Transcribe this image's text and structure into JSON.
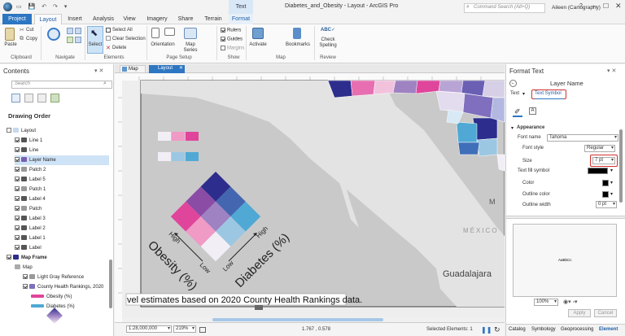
{
  "window": {
    "title": "Diabetes_and_Obesity - Layout - ArcGIS Pro",
    "context_tab_group": "Text",
    "search_placeholder": "Command Search (Alt+Q)",
    "user": "Aileen (Cartography)",
    "help": "?"
  },
  "ribbon_tabs": [
    "Project",
    "Layout",
    "Insert",
    "Analysis",
    "View",
    "Imagery",
    "Share",
    "Terrain",
    "Format"
  ],
  "ribbon": {
    "clipboard": {
      "paste": "Paste",
      "cut": "Cut",
      "copy": "Copy",
      "group": "Clipboard"
    },
    "navigate": {
      "group": "Navigate"
    },
    "elements": {
      "select": "Select",
      "select_all": "Select All",
      "clear_selection": "Clear Selection",
      "delete": "Delete",
      "group": "Elements"
    },
    "page_setup": {
      "orientation": "Orientation",
      "map_series": "Map Series",
      "group": "Page Setup"
    },
    "show": {
      "rulers": "Rulers",
      "guides": "Guides",
      "margins": "Margins",
      "group": "Show"
    },
    "map": {
      "activate": "Activate",
      "bookmarks": "Bookmarks",
      "group": "Map"
    },
    "review": {
      "check_spelling": "Check Spelling",
      "group": "Review"
    }
  },
  "contents": {
    "title": "Contents",
    "search_placeholder": "Search",
    "drawing_order": "Drawing Order",
    "items": [
      {
        "label": "Layout",
        "checked": false
      },
      {
        "label": "Line 1",
        "checked": true
      },
      {
        "label": "Line",
        "checked": true
      },
      {
        "label": "Layer Name",
        "checked": true
      },
      {
        "label": "Patch 2",
        "checked": true
      },
      {
        "label": "Label 5",
        "checked": true
      },
      {
        "label": "Patch 1",
        "checked": true
      },
      {
        "label": "Label 4",
        "checked": true
      },
      {
        "label": "Patch",
        "checked": true
      },
      {
        "label": "Label 3",
        "checked": true
      },
      {
        "label": "Label 2",
        "checked": true
      },
      {
        "label": "Label 1",
        "checked": true
      },
      {
        "label": "Label",
        "checked": true
      },
      {
        "label": "Map Frame",
        "checked": true
      },
      {
        "label": "Map",
        "checked": false
      },
      {
        "label": "Light Gray Reference",
        "checked": true
      },
      {
        "label": "County Health Rankings, 2020",
        "checked": true
      },
      {
        "label": "Obesity (%)",
        "checked": false
      },
      {
        "label": "Diabetes (%)",
        "checked": false
      }
    ]
  },
  "view_tabs": {
    "map": "Map",
    "layout": "Layout"
  },
  "layout": {
    "obesity_axis": "Obesity (%)",
    "diabetes_axis": "Diabetes (%)",
    "high": "High",
    "low": "Low",
    "country_label": "MÉXICO",
    "city_label": "Guadalajara",
    "partial_label": "M",
    "footer_text": "vel estimates based on 2020 County Health Rankings data.",
    "colors": {
      "top": "#2c2d8c",
      "left": "#e0459c",
      "right": "#4fa9d4",
      "bottom": "#f2eef5",
      "center": "#9e82c2"
    }
  },
  "statusbar": {
    "scale": "1:28,000,000",
    "zoom": "219%",
    "coords": "1.767 , 0.578",
    "selected": "Selected Elements: 1"
  },
  "format_text": {
    "pane_title": "Format Text",
    "element_name": "Layer Name",
    "text_label": "Text",
    "text_symbol": "Text Symbol",
    "appearance": "Appearance",
    "font_name_label": "Font name",
    "font_name": "Tahoma",
    "font_style_label": "Font style",
    "font_style": "Regular",
    "size_label": "Size",
    "size": "7 pt",
    "fill_symbol_label": "Text fill symbol",
    "color_label": "Color",
    "outline_color_label": "Outline color",
    "outline_width_label": "Outline width",
    "outline_width": "0 pt",
    "preview_text": "AaBbCc",
    "zoom": "100%",
    "apply": "Apply",
    "cancel": "Cancel",
    "bottom_tabs": [
      "Catalog",
      "Symbology",
      "Geoprocessing",
      "Element"
    ]
  }
}
